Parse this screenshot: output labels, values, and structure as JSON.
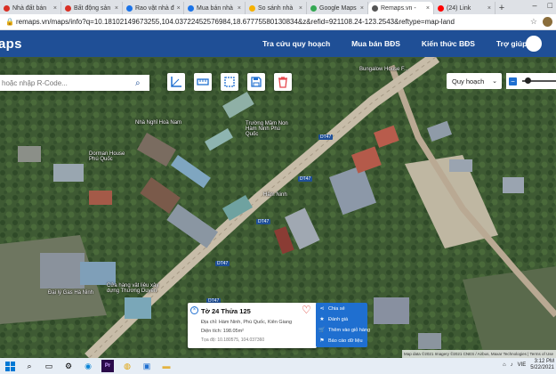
{
  "browser": {
    "tabs": [
      {
        "label": "Nhà đất bán",
        "color": "#d93025",
        "active": false
      },
      {
        "label": "Bất động sản",
        "color": "#d93025",
        "active": false
      },
      {
        "label": "Rao vặt nhà đ",
        "color": "#1a73e8",
        "active": false
      },
      {
        "label": "Mua bán nhà",
        "color": "#1a73e8",
        "active": false
      },
      {
        "label": "So sánh nhà",
        "color": "#f6b100",
        "active": false
      },
      {
        "label": "Google Maps",
        "color": "#34a853",
        "active": false
      },
      {
        "label": "Remaps.vn -",
        "color": "#555555",
        "active": true
      },
      {
        "label": "(24) Link",
        "color": "#ff0000",
        "active": false
      }
    ],
    "url": "remaps.vn/maps/info?q=10.18102149673255,104.03722452576984,18.67775580130834&z&refid=921108.24-123.2543&reftype=map-land"
  },
  "site": {
    "logo": "aps",
    "nav": [
      "Tra cứu quy hoạch",
      "Mua bán BĐS",
      "Kiến thức BĐS",
      "Trợ giúp"
    ]
  },
  "search": {
    "placeholder": "hoặc nhập R-Code..."
  },
  "planning": {
    "label": "Quy hoạch",
    "opacity": 0.15
  },
  "map_labels": [
    "Bungalow House F...",
    "Nhà Nghỉ Hoà Nam",
    "Dorman House Phú Quốc",
    "Trường Mầm Non Hàm Ninh Phú Quốc",
    "Hàm Ninh",
    "Cửa hàng vật liệu xây dựng Thương Duyên",
    "Đại lý Gas Hà Ninh"
  ],
  "road_labels": [
    "DT47",
    "DT47",
    "DT47",
    "DT47",
    "DT47"
  ],
  "card": {
    "title": "Tờ 24 Thửa 125",
    "address": "Địa chỉ: Hàm Ninh, Phú Quốc, Kiên Giang",
    "area": "Diện tích: 198.05m²",
    "coords": "Tọa độ: 10.180575, 104.037360"
  },
  "menu": [
    {
      "icon": "share-icon",
      "glyph": "⋖",
      "label": "Chia sẻ"
    },
    {
      "icon": "review-icon",
      "glyph": "★",
      "label": "Đánh giá"
    },
    {
      "icon": "cart-icon",
      "glyph": "🛒",
      "label": "Thêm vào giỏ hàng"
    },
    {
      "icon": "report-icon",
      "glyph": "⚑",
      "label": "Báo cáo dữ liệu"
    }
  ],
  "attribution": "Map data ©2021 Imagery ©2021 CNES / Airbus, Maxar Technologies | Terms of Use",
  "taskbar": {
    "lang": "VIE",
    "time": "3:12 PM",
    "date": "5/22/2021"
  }
}
